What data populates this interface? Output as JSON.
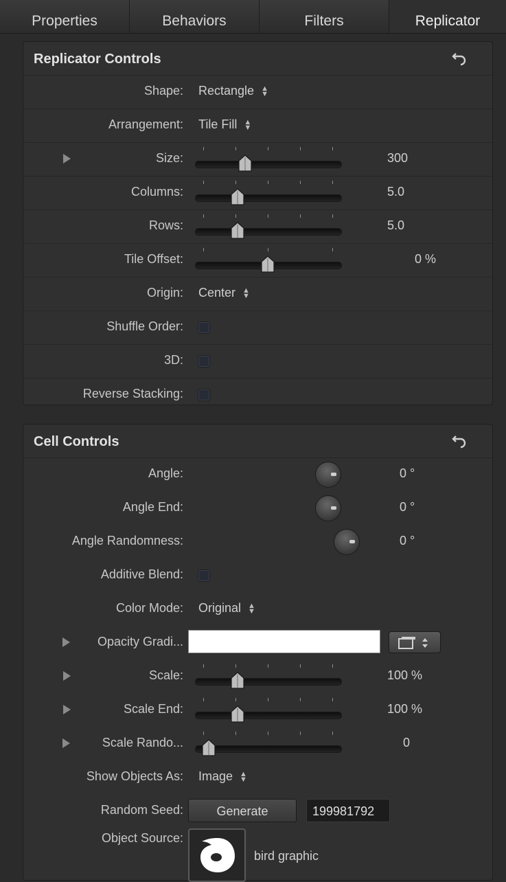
{
  "tabs": [
    "Properties",
    "Behaviors",
    "Filters",
    "Replicator"
  ],
  "replicator_controls": {
    "title": "Replicator Controls",
    "shape": {
      "label": "Shape:",
      "value": "Rectangle"
    },
    "arrangement": {
      "label": "Arrangement:",
      "value": "Tile Fill"
    },
    "size": {
      "label": "Size:",
      "value": "300"
    },
    "columns": {
      "label": "Columns:",
      "value": "5.0"
    },
    "rows": {
      "label": "Rows:",
      "value": "5.0"
    },
    "tile_offset": {
      "label": "Tile Offset:",
      "value": "0 %"
    },
    "origin": {
      "label": "Origin:",
      "value": "Center"
    },
    "shuffle_order": {
      "label": "Shuffle Order:"
    },
    "three_d": {
      "label": "3D:"
    },
    "reverse_stacking": {
      "label": "Reverse Stacking:"
    }
  },
  "cell_controls": {
    "title": "Cell Controls",
    "angle": {
      "label": "Angle:",
      "value": "0 °"
    },
    "angle_end": {
      "label": "Angle End:",
      "value": "0 °"
    },
    "angle_randomness": {
      "label": "Angle Randomness:",
      "value": "0 °"
    },
    "additive_blend": {
      "label": "Additive Blend:"
    },
    "color_mode": {
      "label": "Color Mode:",
      "value": "Original"
    },
    "opacity_gradient": {
      "label": "Opacity Gradi..."
    },
    "scale": {
      "label": "Scale:",
      "value": "100 %"
    },
    "scale_end": {
      "label": "Scale End:",
      "value": "100 %"
    },
    "scale_randomness": {
      "label": "Scale Rando...",
      "value": "0"
    },
    "show_objects_as": {
      "label": "Show Objects As:",
      "value": "Image"
    },
    "random_seed": {
      "label": "Random Seed:",
      "button": "Generate",
      "value": "199981792"
    },
    "object_source": {
      "label": "Object Source:",
      "name": "bird graphic"
    }
  },
  "slider_levels": {
    "size": 0.33,
    "columns": 0.27,
    "rows": 0.27,
    "tile_offset": 0.5,
    "scale": 0.27,
    "scale_end": 0.27,
    "scale_randomness": 0.05
  },
  "icons": {
    "reset": "undo-arrow-icon",
    "disclosure": "disclosure-triangle-icon",
    "popup": "popup-arrows-icon",
    "dial": "angle-dial-icon",
    "object": "bird-graphic-thumbnail"
  },
  "colors": {
    "background": "#2b2b2b",
    "panel": "#303030",
    "accent": "#ffffff"
  }
}
